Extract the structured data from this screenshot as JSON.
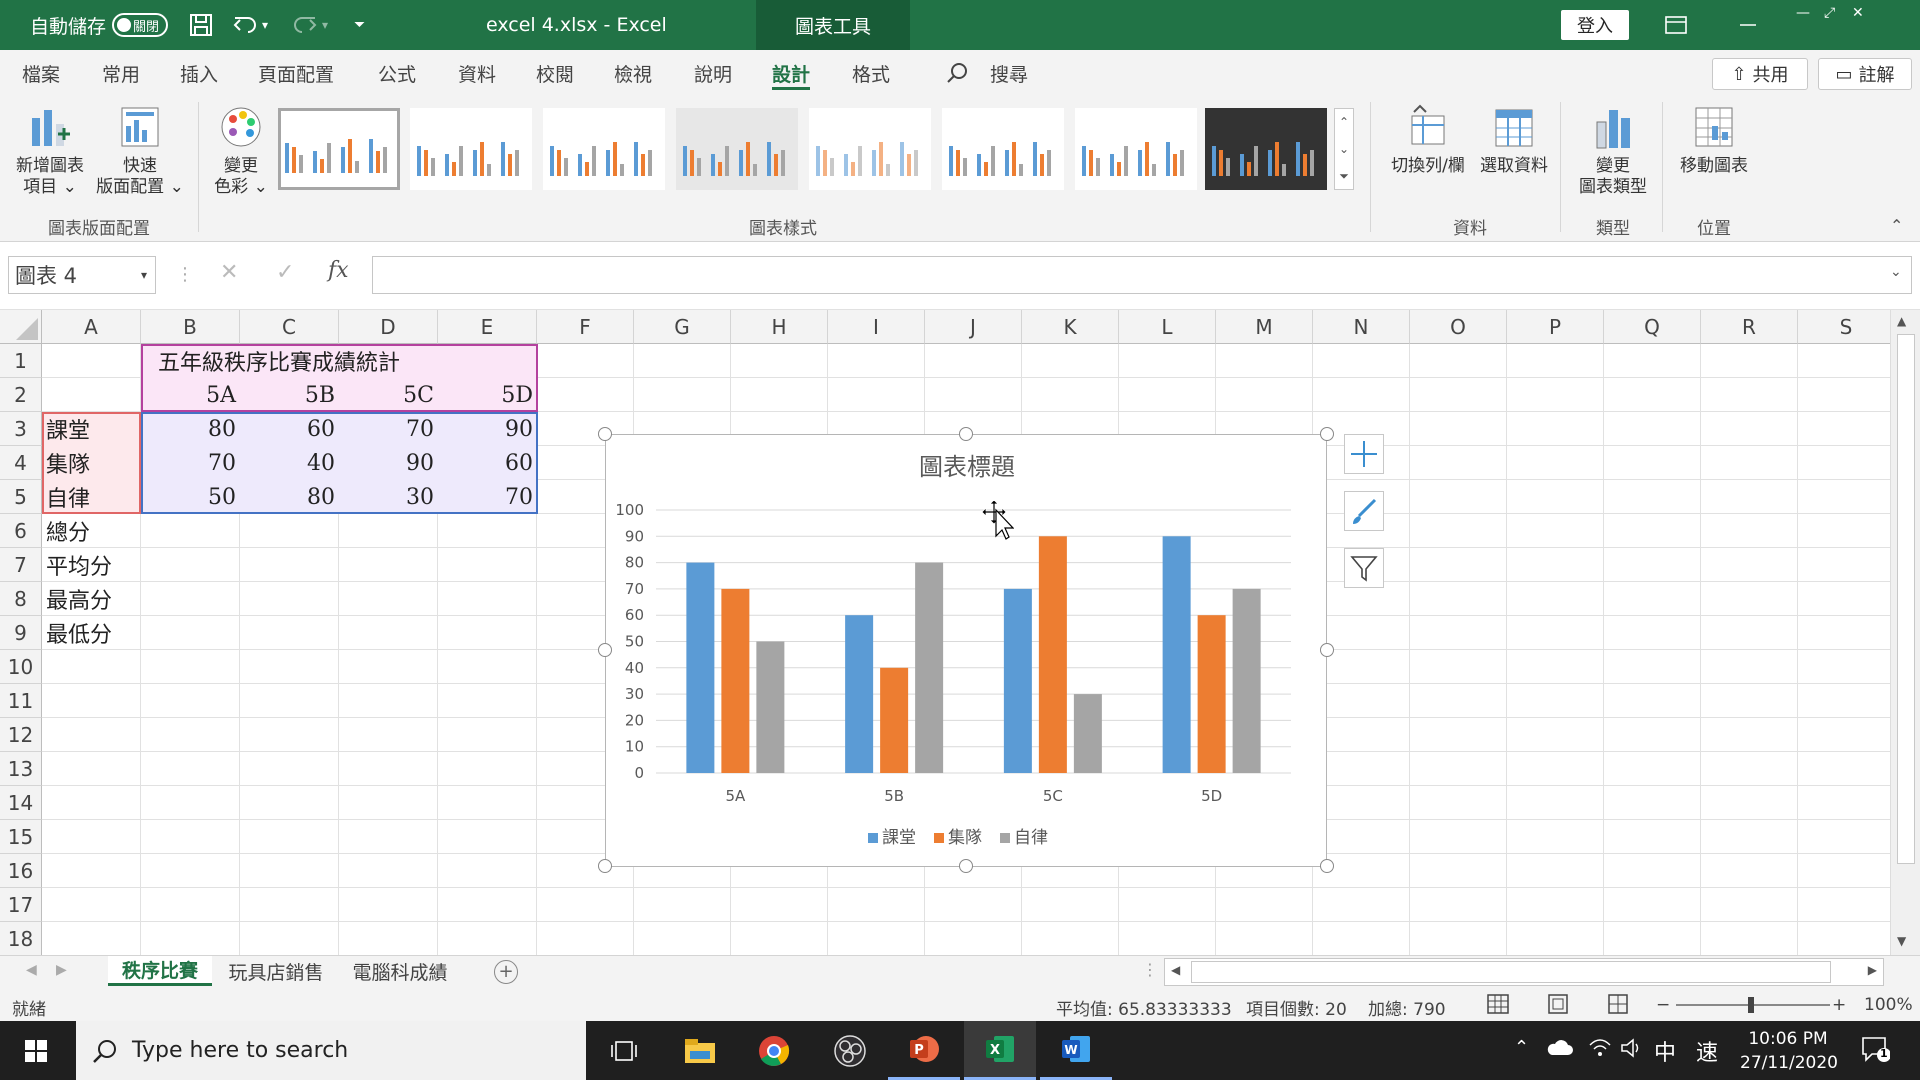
{
  "titlebar": {
    "autosave_label": "自動儲存",
    "autosave_state": "關閉",
    "file_title": "excel 4.xlsx  -  Excel",
    "tools_tab": "圖表工具",
    "login": "登入"
  },
  "tabs": [
    "檔案",
    "常用",
    "插入",
    "頁面配置",
    "公式",
    "資料",
    "校閱",
    "檢視",
    "說明",
    "設計",
    "格式"
  ],
  "search_label": "搜尋",
  "share_label": "共用",
  "comment_label": "註解",
  "ribbon": {
    "add_element": [
      "新增圖表",
      "項目"
    ],
    "quick_layout": [
      "快速",
      "版面配置"
    ],
    "change_color": [
      "變更",
      "色彩"
    ],
    "group_layout": "圖表版面配置",
    "group_styles": "圖表樣式",
    "switch_rowcol": "切換列/欄",
    "select_data": "選取資料",
    "group_data": "資料",
    "change_type": [
      "變更",
      "圖表類型"
    ],
    "group_type": "類型",
    "move_chart": "移動圖表",
    "group_location": "位置"
  },
  "namebox": "圖表 4",
  "fx": "fx",
  "columns": [
    "A",
    "B",
    "C",
    "D",
    "E",
    "F",
    "G",
    "H",
    "I",
    "J",
    "K",
    "L",
    "M",
    "N",
    "O",
    "P",
    "Q",
    "R",
    "S"
  ],
  "rows": [
    "1",
    "2",
    "3",
    "4",
    "5",
    "6",
    "7",
    "8",
    "9",
    "10",
    "11",
    "12",
    "13",
    "14",
    "15",
    "16",
    "17",
    "18"
  ],
  "sheet": {
    "title": "五年級秩序比賽成績統計",
    "headers": [
      "5A",
      "5B",
      "5C",
      "5D"
    ],
    "labels": [
      "課堂",
      "集隊",
      "自律",
      "總分",
      "平均分",
      "最高分",
      "最低分"
    ],
    "values": [
      [
        "80",
        "60",
        "70",
        "90"
      ],
      [
        "70",
        "40",
        "90",
        "60"
      ],
      [
        "50",
        "80",
        "30",
        "70"
      ]
    ]
  },
  "sheet_tabs": [
    "秩序比賽",
    "玩具店銷售",
    "電腦科成績"
  ],
  "status": {
    "ready": "就緒",
    "average": "平均值: 65.83333333",
    "count": "項目個數: 20",
    "sum": "加總: 790",
    "zoom": "100%"
  },
  "taskbar": {
    "search_placeholder": "Type here to search",
    "time": "10:06 PM",
    "date": "27/11/2020",
    "ime1": "中",
    "ime2": "速",
    "notifications": "1"
  },
  "chart_data": {
    "type": "bar",
    "title": "圖表標題",
    "categories": [
      "5A",
      "5B",
      "5C",
      "5D"
    ],
    "series": [
      {
        "name": "課堂",
        "values": [
          80,
          60,
          70,
          90
        ],
        "color": "#5b9bd5"
      },
      {
        "name": "集隊",
        "values": [
          70,
          40,
          90,
          60
        ],
        "color": "#ed7d31"
      },
      {
        "name": "自律",
        "values": [
          50,
          80,
          30,
          70
        ],
        "color": "#a5a5a5"
      }
    ],
    "ylim": [
      0,
      100
    ],
    "yticks": [
      "0",
      "10",
      "20",
      "30",
      "40",
      "50",
      "60",
      "70",
      "80",
      "90",
      "100"
    ],
    "grid": true,
    "legend": "bottom"
  }
}
